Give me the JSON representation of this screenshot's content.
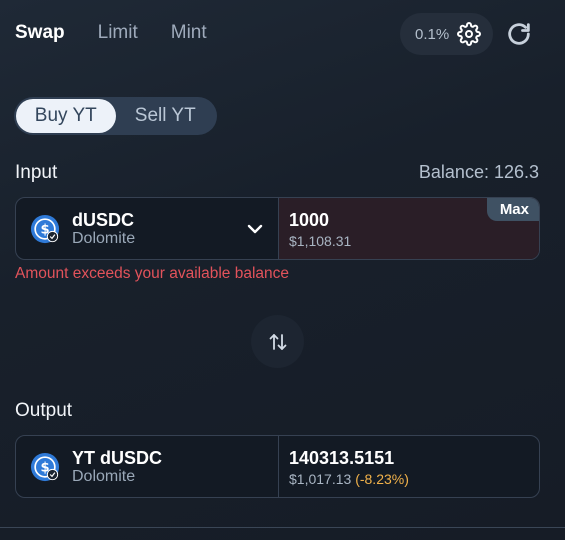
{
  "tabs": [
    {
      "label": "Swap",
      "active": true
    },
    {
      "label": "Limit",
      "active": false
    },
    {
      "label": "Mint",
      "active": false
    }
  ],
  "slippage": {
    "value": "0.1%",
    "icon": "gear-icon"
  },
  "refresh": {
    "icon": "refresh-icon"
  },
  "toggle": {
    "buy_label": "Buy YT",
    "sell_label": "Sell YT",
    "selected": "Buy YT"
  },
  "input": {
    "label": "Input",
    "balance": "Balance: 126.3",
    "token_name": "dUSDC",
    "token_sub": "Dolomite",
    "amount": "1000",
    "usd": "$1,108.31",
    "max_label": "Max",
    "error": "Amount exceeds your available balance"
  },
  "output": {
    "label": "Output",
    "token_name": "YT dUSDC",
    "token_sub": "Dolomite",
    "amount": "140313.5151",
    "usd": "$1,017.13",
    "pct": "(-8.23%)"
  },
  "colors": {
    "error": "#e2535b",
    "warning": "#f2b24a",
    "token_blue": "#2f7ad8"
  }
}
